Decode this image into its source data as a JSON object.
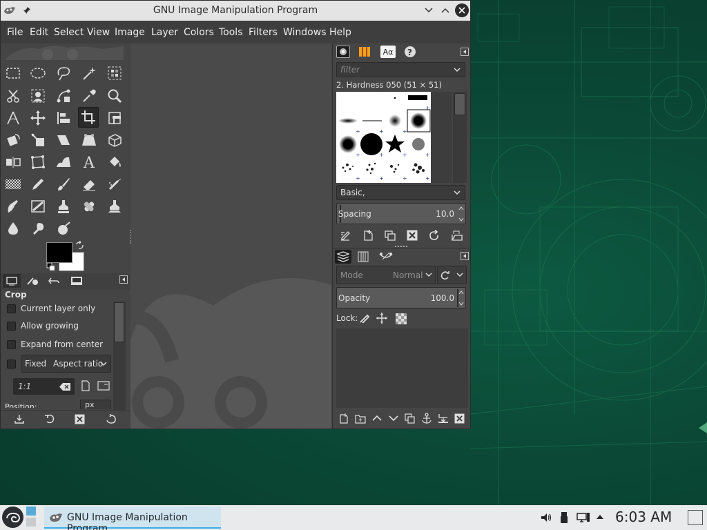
{
  "window": {
    "title": "GNU Image Manipulation Program"
  },
  "menubar": {
    "items": [
      "File",
      "Edit",
      "Select",
      "View",
      "Image",
      "Layer",
      "Colors",
      "Tools",
      "Filters",
      "Windows",
      "Help"
    ]
  },
  "tool_options": {
    "title": "Crop",
    "current_layer_only": "Current layer only",
    "allow_growing": "Allow growing",
    "expand_from_center": "Expand from center",
    "fixed_label": "Fixed",
    "fixed_select": "Aspect ratio",
    "ratio_value": "1:1",
    "position_label": "Position:",
    "unit_value": "px"
  },
  "brushes": {
    "filter_placeholder": "filter",
    "selected_brush": "2. Hardness 050 (51 × 51)",
    "tag_value": "Basic,",
    "spacing_label": "Spacing",
    "spacing_value": "10.0"
  },
  "layers": {
    "mode_label": "Mode",
    "mode_value": "Normal",
    "opacity_label": "Opacity",
    "opacity_value": "100.0",
    "lock_label": "Lock:"
  },
  "taskbar": {
    "task_label": "GNU Image Manipulation Program",
    "clock": "6:03 AM"
  },
  "colors": {
    "desktop": "#0b4936",
    "window_bg": "#454545",
    "titlebar": "#e4e4e4",
    "taskbar": "#e8eaeb",
    "close_button": "#2b2b2b",
    "fg_color": "#000000",
    "bg_color": "#ffffff"
  }
}
